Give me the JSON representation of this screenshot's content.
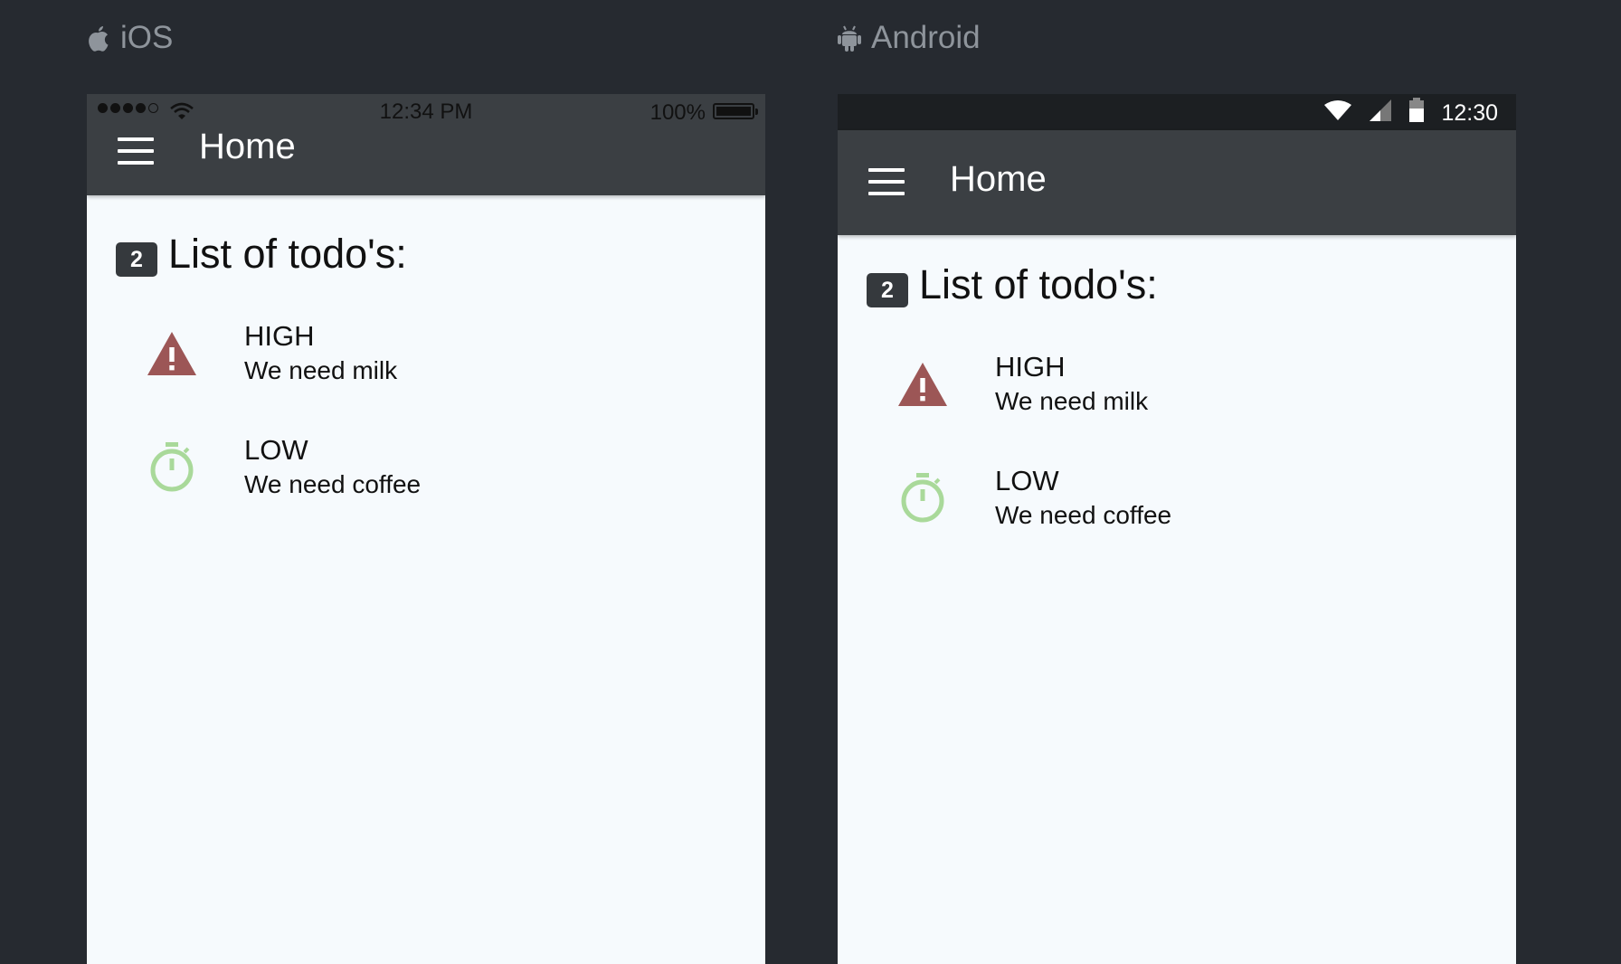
{
  "platforms": {
    "ios": {
      "label": "iOS",
      "icon": "apple-icon"
    },
    "android": {
      "label": "Android",
      "icon": "android-icon"
    }
  },
  "ios": {
    "status_bar": {
      "time": "12:34 PM",
      "battery": "100%"
    },
    "header": {
      "title": "Home"
    }
  },
  "android": {
    "status_bar": {
      "time": "12:30"
    },
    "header": {
      "title": "Home"
    }
  },
  "list": {
    "count": "2",
    "title": "List of todo's:",
    "items": [
      {
        "priority": "HIGH",
        "text": "We need milk",
        "icon": "warning-icon",
        "color": "#9c5656"
      },
      {
        "priority": "LOW",
        "text": "We need coffee",
        "icon": "stopwatch-icon",
        "color": "#a9d99a"
      }
    ]
  },
  "colors": {
    "background": "#262a30",
    "header": "#3b3f43",
    "content": "#f6fafd",
    "badge": "#35393d"
  }
}
